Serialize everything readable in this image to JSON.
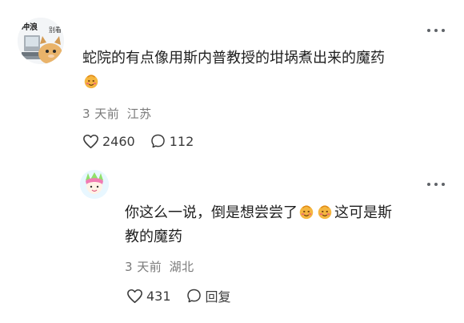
{
  "main_comment": {
    "avatar_text_top": "冲浪",
    "avatar_text_side": "别看",
    "text": "蛇院的有点像用斯内普教授的坩埚煮出来的魔药",
    "time": "3 天前",
    "location": "江苏",
    "likes": "2460",
    "replies": "112",
    "emoji_count": 1
  },
  "reply_comment": {
    "text_line1": "你这么一说，倒是想尝尝了",
    "text_line2_a": "这可是斯",
    "text_line2_b": "教的魔药",
    "time": "3 天前",
    "location": "湖北",
    "likes": "431",
    "reply_label": "回复"
  },
  "icons": {
    "more": "more-icon",
    "like": "heart-icon",
    "comment": "comment-bubble-icon",
    "emoji": "smirk-emoji-icon"
  },
  "colors": {
    "text": "#1f1f1f",
    "meta": "#7a7a7a",
    "icon": "#3b3b3b",
    "emoji_face": "#f5b63f",
    "emoji_cheek": "#ef6f6f"
  }
}
